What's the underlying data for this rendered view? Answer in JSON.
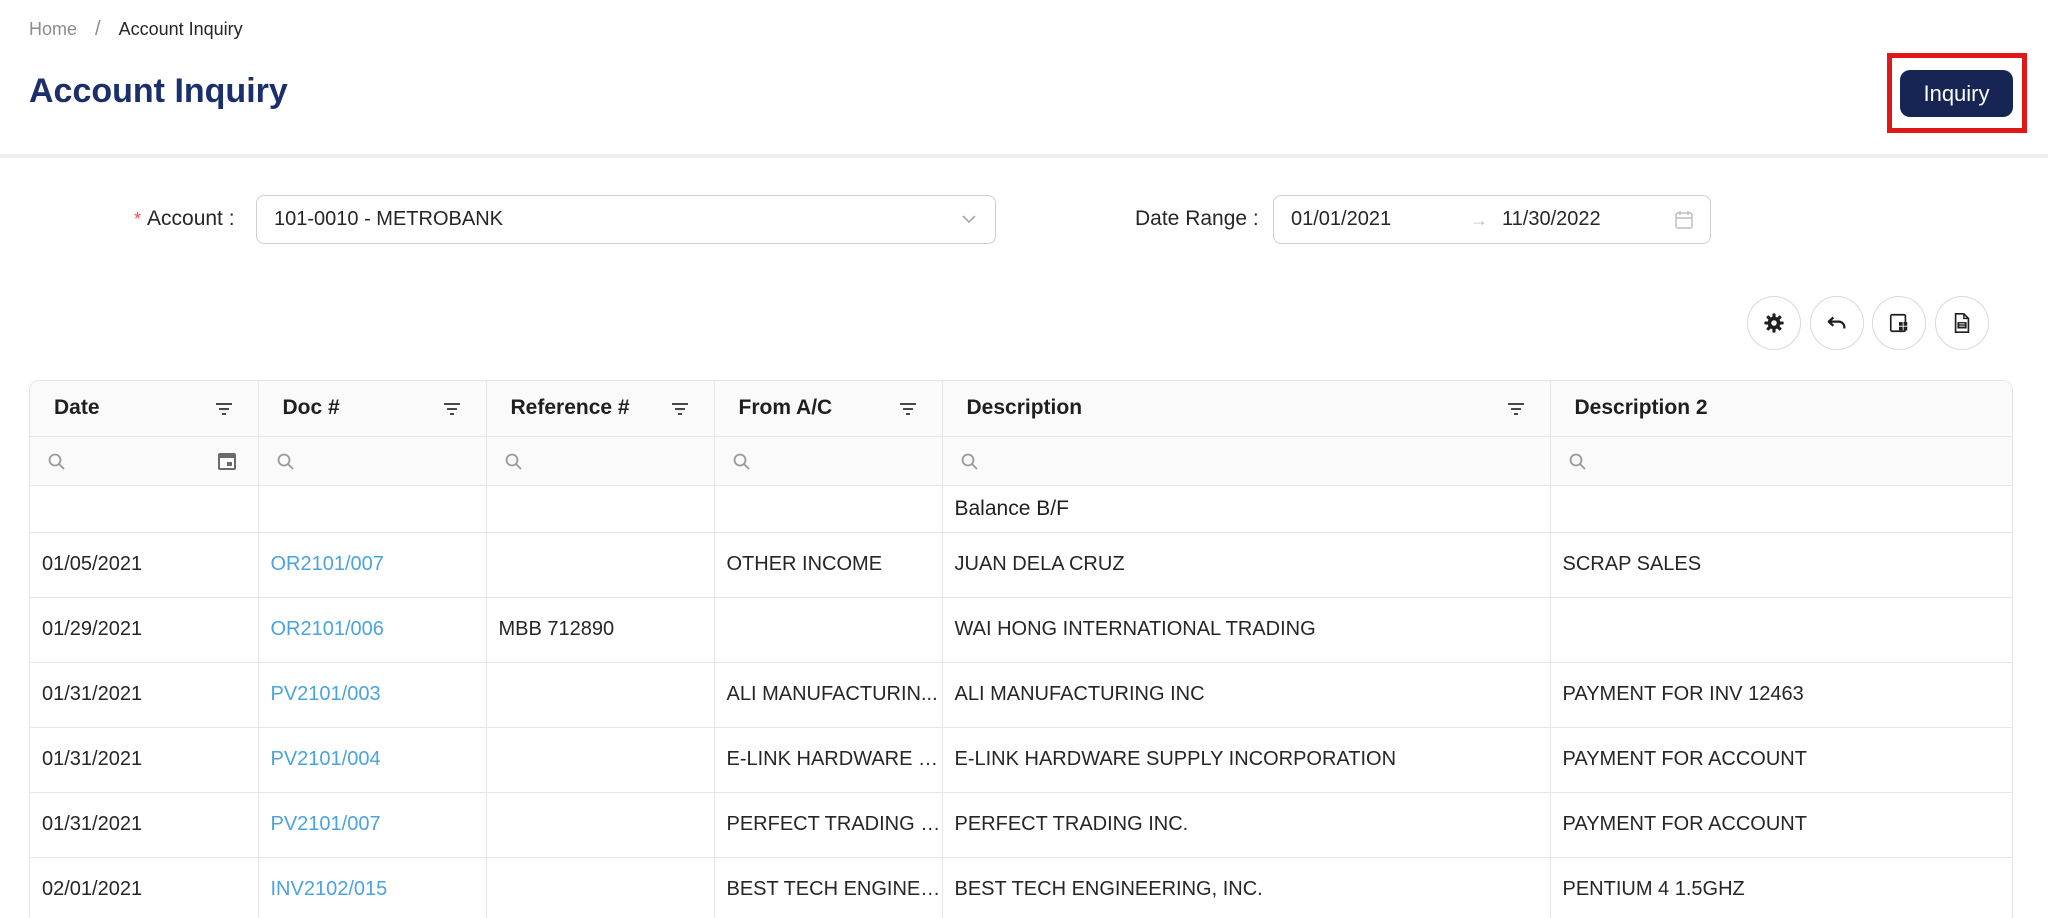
{
  "breadcrumb": {
    "home": "Home",
    "separator": "/",
    "current": "Account Inquiry"
  },
  "page": {
    "title": "Account Inquiry"
  },
  "actions": {
    "inquiry_label": "Inquiry"
  },
  "filters": {
    "account_label": "Account :",
    "account_required_mark": "*",
    "account_value": "101-0010 - METROBANK",
    "date_range_label": "Date Range :",
    "date_from": "01/01/2021",
    "date_arrow": "→",
    "date_to": "11/30/2022"
  },
  "toolbar": {
    "icons": [
      "gear-icon",
      "undo-icon",
      "export-excel-icon",
      "export-pdf-icon"
    ]
  },
  "table": {
    "columns": [
      "Date",
      "Doc #",
      "Reference #",
      "From A/C",
      "Description",
      "Description 2"
    ],
    "balance_row": {
      "description": "Balance B/F"
    },
    "rows": [
      [
        "01/05/2021",
        "OR2101/007",
        "",
        "OTHER INCOME",
        "JUAN DELA CRUZ",
        "SCRAP SALES"
      ],
      [
        "01/29/2021",
        "OR2101/006",
        "MBB 712890",
        "",
        "WAI HONG INTERNATIONAL TRADING",
        ""
      ],
      [
        "01/31/2021",
        "PV2101/003",
        "",
        "ALI MANUFACTURIN...",
        "ALI MANUFACTURING INC",
        "PAYMENT FOR INV 12463"
      ],
      [
        "01/31/2021",
        "PV2101/004",
        "",
        "E-LINK HARDWARE S...",
        "E-LINK HARDWARE SUPPLY INCORPORATION",
        "PAYMENT FOR ACCOUNT"
      ],
      [
        "01/31/2021",
        "PV2101/007",
        "",
        "PERFECT TRADING I...",
        "PERFECT TRADING INC.",
        "PAYMENT FOR ACCOUNT"
      ],
      [
        "02/01/2021",
        "INV2102/015",
        "",
        "BEST TECH ENGINEE...",
        "BEST TECH ENGINEERING, INC.",
        "PENTIUM 4 1.5GHZ"
      ]
    ]
  },
  "colors": {
    "primary": "#172554",
    "title": "#1a2f6b",
    "link": "#4aa3df",
    "highlight": "#e01818"
  }
}
